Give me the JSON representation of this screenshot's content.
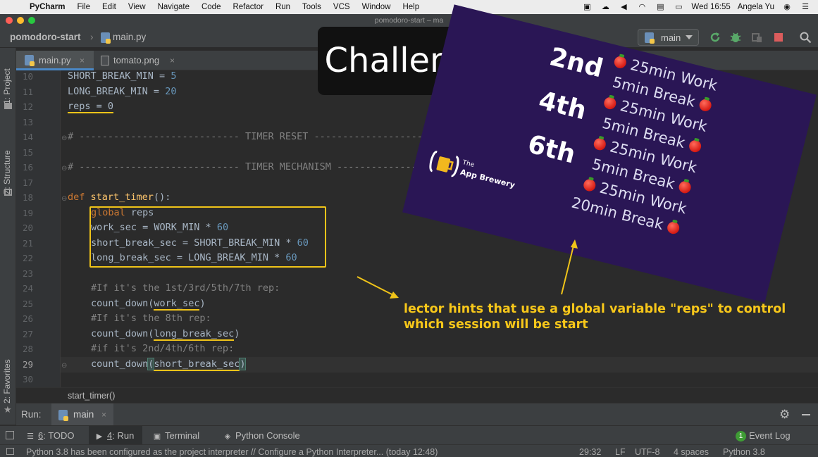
{
  "menubar": {
    "app": "PyCharm",
    "items": [
      "File",
      "Edit",
      "View",
      "Navigate",
      "Code",
      "Refactor",
      "Run",
      "Tools",
      "VCS",
      "Window",
      "Help"
    ],
    "date": "Wed 16:55",
    "user": "Angela Yu"
  },
  "window": {
    "title": "pomodoro-start – ma"
  },
  "navbar": {
    "project": "pomodoro-start",
    "separator": "›",
    "file": "main.py",
    "branch": "main"
  },
  "sidebar": {
    "project": "1: Project",
    "structure": "Z: Structure",
    "favorites": "2: Favorites"
  },
  "tabs": [
    {
      "label": "main.py",
      "close": "×"
    },
    {
      "label": "tomato.png",
      "close": "×"
    }
  ],
  "editor": {
    "line_numbers": [
      "10",
      "11",
      "12",
      "13",
      "14",
      "15",
      "16",
      "17",
      "18",
      "19",
      "20",
      "21",
      "22",
      "23",
      "24",
      "25",
      "26",
      "27",
      "28",
      "29",
      "30"
    ],
    "tokens": {
      "short_break_const": "SHORT_BREAK_MIN",
      "five": "5",
      "long_break_const": "LONG_BREAK_MIN",
      "twenty": "20",
      "reps_decl": "reps = 0",
      "timer_reset": "# ---------------------------- TIMER RESET -------------------------------",
      "timer_mech": "# ---------------------------- TIMER MECHANISM -------------------------------",
      "def": "def",
      "start_timer": "start_timer",
      "def_tail": "():",
      "global": "global",
      "reps": " reps",
      "work_lhs": "work_sec = WORK_MIN * ",
      "sixty": "60",
      "short_lhs": "short_break_sec = SHORT_BREAK_MIN * ",
      "long_lhs": "long_break_sec = LONG_BREAK_MIN * ",
      "c1": "#If it's the 1st/3rd/5th/7th rep:",
      "count_down": "count_down",
      "open": "(",
      "close": ")",
      "work_sec": "work_sec",
      "c2": "#If it's the 8th rep:",
      "long_break_sec": "long_break_sec",
      "c3": "#if it's 2nd/4th/6th rep:",
      "short_break_sec": "short_break_sec",
      "eq": " = "
    },
    "breadcrumb": "start_timer()"
  },
  "run": {
    "label": "Run:",
    "tab": "main",
    "close": "×"
  },
  "tool_tabs": {
    "todo_num": "6",
    "todo": ": TODO",
    "run_num": "4",
    "run": ": Run",
    "terminal": "Terminal",
    "console": "Python Console",
    "event_num": "1",
    "event": "Event Log"
  },
  "status": {
    "message": "Python 3.8 has been configured as the project interpreter // Configure a Python Interpreter... (today 12:48)",
    "position": "29:32",
    "line_sep": "LF",
    "encoding": "UTF-8",
    "indent": "4 spaces",
    "interpreter": "Python 3.8"
  },
  "overlay": {
    "challenge": "Challenge",
    "ordinals": [
      "2nd",
      "4th",
      "6th"
    ],
    "schedule": [
      "25min Work",
      "5min Break",
      "25min Work",
      "5min Break",
      "25min Work",
      "5min Break",
      "25min Work",
      "20min Break"
    ],
    "brand_small": "The",
    "brand": "App Brewery",
    "annotation": "lector hints that use a global variable \"reps\" to control which session will be start",
    "accent": "#f0c419"
  }
}
